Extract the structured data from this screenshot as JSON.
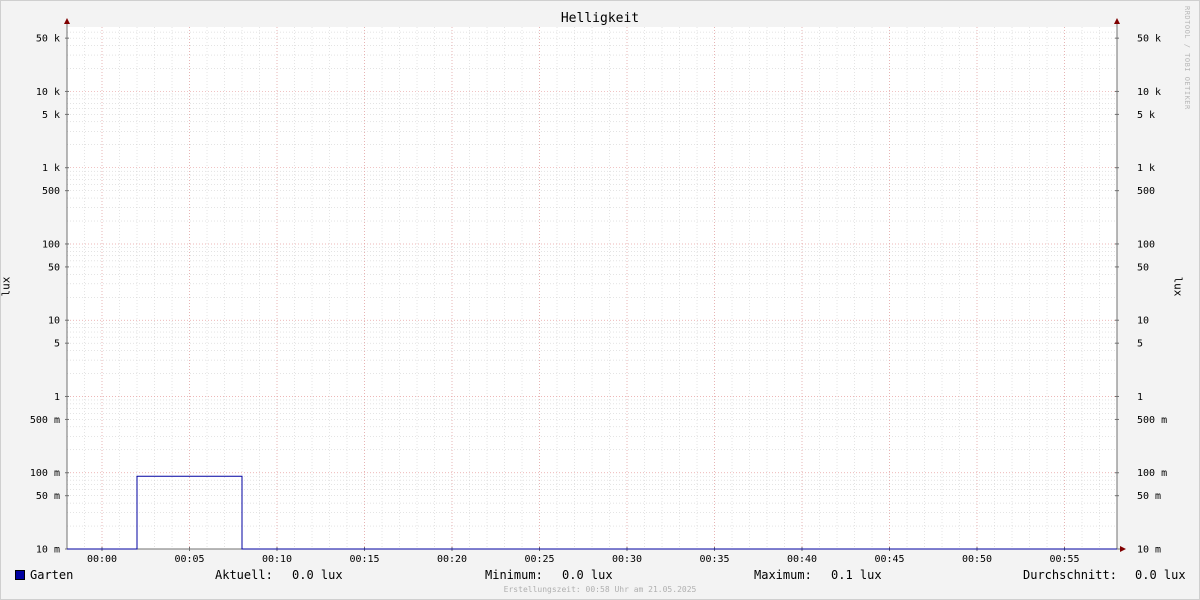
{
  "chart_data": {
    "type": "line",
    "title": "Helligkeit",
    "ylabel": "lux",
    "y_scale": "log",
    "ylim": [
      0.01,
      70000
    ],
    "xlim": [
      "23:58",
      "00:58"
    ],
    "x_ticks": [
      "00:00",
      "00:05",
      "00:10",
      "00:15",
      "00:20",
      "00:25",
      "00:30",
      "00:35",
      "00:40",
      "00:45",
      "00:50",
      "00:55"
    ],
    "y_ticks": [
      {
        "value": 50000,
        "label": "50 k"
      },
      {
        "value": 10000,
        "label": "10 k"
      },
      {
        "value": 5000,
        "label": "5 k"
      },
      {
        "value": 1000,
        "label": "1 k"
      },
      {
        "value": 500,
        "label": "500"
      },
      {
        "value": 100,
        "label": "100"
      },
      {
        "value": 50,
        "label": "50"
      },
      {
        "value": 10,
        "label": "10"
      },
      {
        "value": 5,
        "label": "5"
      },
      {
        "value": 1,
        "label": "1"
      },
      {
        "value": 0.5,
        "label": "500 m"
      },
      {
        "value": 0.1,
        "label": "100 m"
      },
      {
        "value": 0.05,
        "label": "50 m"
      },
      {
        "value": 0.01,
        "label": "10 m"
      }
    ],
    "series": [
      {
        "name": "Garten",
        "color": "#0000a0",
        "points": [
          {
            "x": "23:58",
            "y": 0.0
          },
          {
            "x": "00:02",
            "y": 0.0
          },
          {
            "x": "00:02",
            "y": 0.09
          },
          {
            "x": "00:08",
            "y": 0.09
          },
          {
            "x": "00:08",
            "y": 0.0
          },
          {
            "x": "00:58",
            "y": 0.0
          }
        ]
      }
    ],
    "grid": true,
    "secondary_y_axis": true
  },
  "legend": {
    "series_name": "Garten",
    "current_label": "Aktuell:",
    "current_value": "0.0 lux",
    "min_label": "Minimum:",
    "min_value": "0.0 lux",
    "max_label": "Maximum:",
    "max_value": "0.1 lux",
    "avg_label": "Durchschnitt:",
    "avg_value": "0.0 lux"
  },
  "watermark": "RRDTOOL / TOBI OETIKER",
  "footer": "Erstellungszeit: 00:58 Uhr am 21.05.2025",
  "colors": {
    "background": "#f3f3f3",
    "canvas": "#ffffff",
    "major_grid": "#e8a0a0",
    "minor_grid": "#c8c8c8",
    "line": "#0000a0",
    "arrow": "#800000"
  }
}
